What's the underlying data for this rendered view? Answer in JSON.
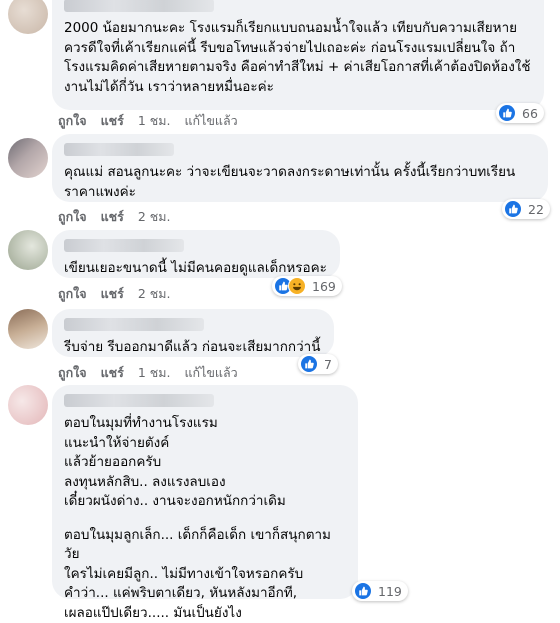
{
  "comments": [
    {
      "text": "2000 น้อยมากนะคะ โรงแรมก็เรียกแบบถนอมน้ำใจแล้ว เทียบกับความเสียหาย ควรดีใจที่เค้าเรียกแค่นี้ รีบขอโทษแล้วจ่ายไปเถอะค่ะ ก่อนโรงแรมเปลี่ยนใจ ถ้าโรงแรมคิดค่าเสียหายตามจริง คือค่าทำสีใหม่ + ค่าเสียโอกาสที่เค้าต้องปิดห้องใช้งานไม่ได้กี่วัน เราว่าหลายหมื่นอะค่ะ",
      "like": "ถูกใจ",
      "reply": "แชร์",
      "time": "1 ชม.",
      "edited": "แก้ไขแล้ว",
      "reaction_count": "66",
      "avatar_colors": [
        "#c9b7a8",
        "#e7ddd4"
      ]
    },
    {
      "text": "คุณแม่ สอนลูกนะคะ ว่าจะเขียนจะวาดลงกระดาษเท่านั้น ครั้งนี้เรียกว่าบทเรียนราคาแพงค่ะ",
      "like": "ถูกใจ",
      "reply": "แชร์",
      "time": "2 ชม.",
      "reaction_count": "22",
      "avatar_colors": [
        "#8c8a91",
        "#d9c7c2"
      ]
    },
    {
      "text": "เขียนเยอะขนาดนี้ ไม่มีคนคอยดูแลเด็กหรอคะ",
      "like": "ถูกใจ",
      "reply": "แชร์",
      "time": "2 ชม.",
      "reaction_count": "169",
      "avatar_colors": [
        "#9aa48f",
        "#e4e7de"
      ]
    },
    {
      "text": "รีบจ่าย รีบออกมาดีแล้ว ก่อนจะเสียมากกว่านี้",
      "like": "ถูกใจ",
      "reply": "แชร์",
      "time": "1 ชม.",
      "edited": "แก้ไขแล้ว",
      "reaction_count": "7",
      "avatar_colors": [
        "#b79d85",
        "#efe6dc"
      ]
    },
    {
      "text": "ตอบในมุมที่ทำงานโรงแรม\nแนะนำให้จ่ายตังค์\nแล้วย้ายออกครับ\nลงทุนหลักสิบ.. ลงแรงลบเอง\nเดี๋ยวผนังด่าง.. งานจะงอกหนักกว่าเดิม",
      "text2": "ตอบในมุมลูกเล็ก... เด็กก็คือเด็ก เขาก็สนุกตามวัย\nใครไม่เคยมีลูก.. ไม่มีทางเข้าใจหรอกครับ\nคำว่า... แค่พริบตาเดียว, หันหลังมาอีกที,\nเผลอแป๊ปเดียว..... มันเป็นยังไง",
      "reaction_count": "119",
      "avatar_colors": [
        "#e3b6b8",
        "#f6e8e8"
      ]
    }
  ]
}
